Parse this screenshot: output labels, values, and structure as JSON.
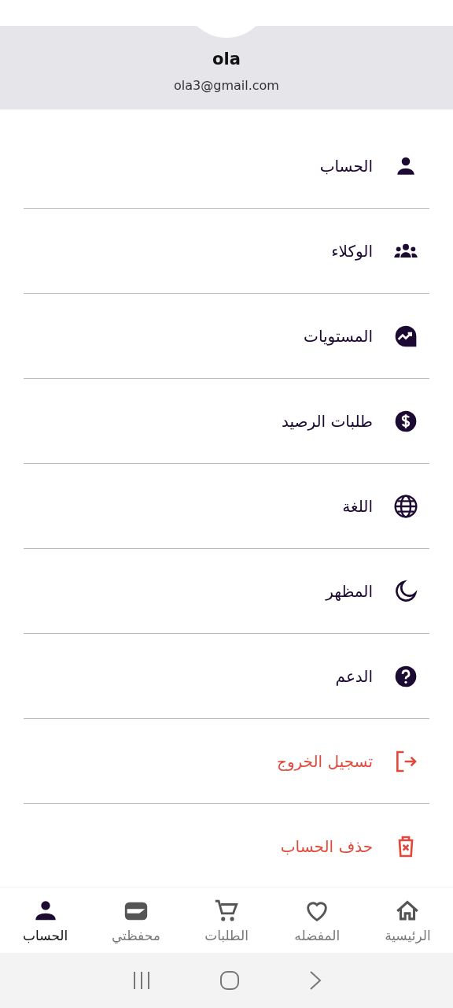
{
  "profile": {
    "name": "ola",
    "email": "ola3@gmail.com"
  },
  "menu": [
    {
      "label": "الحساب",
      "kind": "normal"
    },
    {
      "label": "الوكلاء",
      "kind": "normal"
    },
    {
      "label": "المستويات",
      "kind": "normal"
    },
    {
      "label": "طلبات الرصيد",
      "kind": "normal"
    },
    {
      "label": "اللغة",
      "kind": "normal"
    },
    {
      "label": "المظهر",
      "kind": "normal"
    },
    {
      "label": "الدعم",
      "kind": "normal"
    },
    {
      "label": "تسجيل الخروج",
      "kind": "danger"
    },
    {
      "label": "حذف الحساب",
      "kind": "danger"
    }
  ],
  "bottom_nav": [
    {
      "label": "الرئيسية",
      "selected": false
    },
    {
      "label": "المفضله",
      "selected": false
    },
    {
      "label": "الطلبات",
      "selected": false
    },
    {
      "label": "محفظتي",
      "selected": false
    },
    {
      "label": "الحساب",
      "selected": true
    }
  ]
}
